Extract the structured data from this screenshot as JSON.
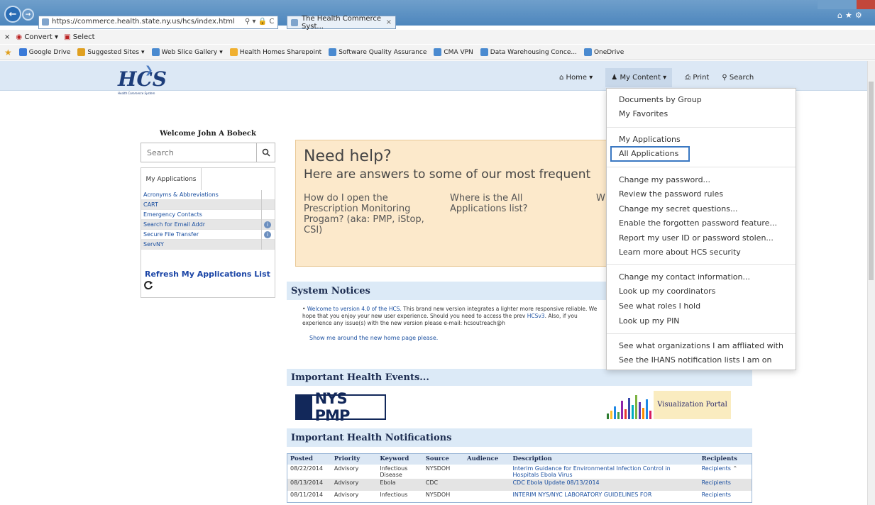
{
  "browser": {
    "url": "https://commerce.health.state.ny.us/hcs/index.html",
    "tab_title": "The Health Commerce Syst...",
    "command_bar": [
      "Convert",
      "Select"
    ],
    "favorites": [
      "Google Drive",
      "Suggested Sites",
      "Web Slice Gallery",
      "Health Homes Sharepoint",
      "Software Quality Assurance",
      "CMA VPN",
      "Data Warehousing Conce...",
      "OneDrive"
    ]
  },
  "header": {
    "logo_text": "HCS",
    "logo_sub": "Health Commerce System",
    "nav": {
      "home": "Home",
      "my_content": "My Content",
      "print": "Print",
      "search": "Search"
    }
  },
  "sidebar": {
    "welcome": "Welcome John A Bobeck",
    "search_placeholder": "Search",
    "tab_label": "My Applications",
    "apps": [
      "Acronyms & Abbreviations",
      "CART",
      "Emergency Contacts",
      "Search for Email Addr",
      "Secure File Transfer",
      "ServNY"
    ],
    "refresh_label": "Refresh My Applications List"
  },
  "help": {
    "title": "Need help?",
    "subtitle": "Here are answers to some of our most frequent",
    "q1": "How do I open the Prescription Monitoring Progam? (aka: PMP, iStop, CSI)",
    "q2": "Where is the All Applications list?",
    "q3": "Wh"
  },
  "system_notices": {
    "heading": "System Notices",
    "link1": "Welcome to version 4.0 of the HCS.",
    "text1": " This brand new version integrates a lighter more responsive reliable. We hope that you enjoy your new user experience. Should you need to access the prev",
    "link2": "HCSv3",
    "text2": ". Also, if you experience any issue(s) with the new version please e-mail: hcsoutreach@h",
    "show_me": "Show me around the new home page please."
  },
  "events": {
    "heading": "Important Health Events...",
    "nyspmp": "NYS PMP",
    "viz_portal": "Visualization Portal"
  },
  "notifications": {
    "heading": "Important Health Notifications",
    "columns": [
      "Posted",
      "Priority",
      "Keyword",
      "Source",
      "Audience",
      "Description",
      "Recipients"
    ],
    "rows": [
      {
        "posted": "08/22/2014",
        "priority": "Advisory",
        "keyword": "Infectious Disease",
        "source": "NYSDOH",
        "audience": "",
        "description": "Interim Guidance for Environmental Infection Control in Hospitals Ebola Virus",
        "recipients": "Recipients"
      },
      {
        "posted": "08/13/2014",
        "priority": "Advisory",
        "keyword": "Ebola",
        "source": "CDC",
        "audience": "",
        "description": "CDC Ebola Update 08/13/2014",
        "recipients": "Recipients"
      },
      {
        "posted": "08/11/2014",
        "priority": "Advisory",
        "keyword": "Infectious",
        "source": "NYSDOH",
        "audience": "",
        "description": "INTERIM NYS/NYC LABORATORY GUIDELINES FOR",
        "recipients": "Recipients"
      }
    ]
  },
  "dropdown": {
    "group1": [
      "Documents by Group",
      "My Favorites"
    ],
    "group2": [
      "My Applications",
      "All Applications"
    ],
    "group3": [
      "Change my password...",
      "Review the password rules",
      "Change my secret questions...",
      "Enable the forgotten password feature...",
      "Report my user ID or password stolen...",
      "Learn more about HCS security"
    ],
    "group4": [
      "Change my contact information...",
      "Look up my coordinators",
      "See what roles I hold",
      "Look up my PIN"
    ],
    "group5": [
      "See what organizations I am affliated with",
      "See the IHANS notification lists I am on"
    ]
  },
  "colors": {
    "accent": "#3a78c2",
    "header_bg": "#dce8f5",
    "help_bg": "#fce9cb",
    "link": "#1a4fa0"
  }
}
